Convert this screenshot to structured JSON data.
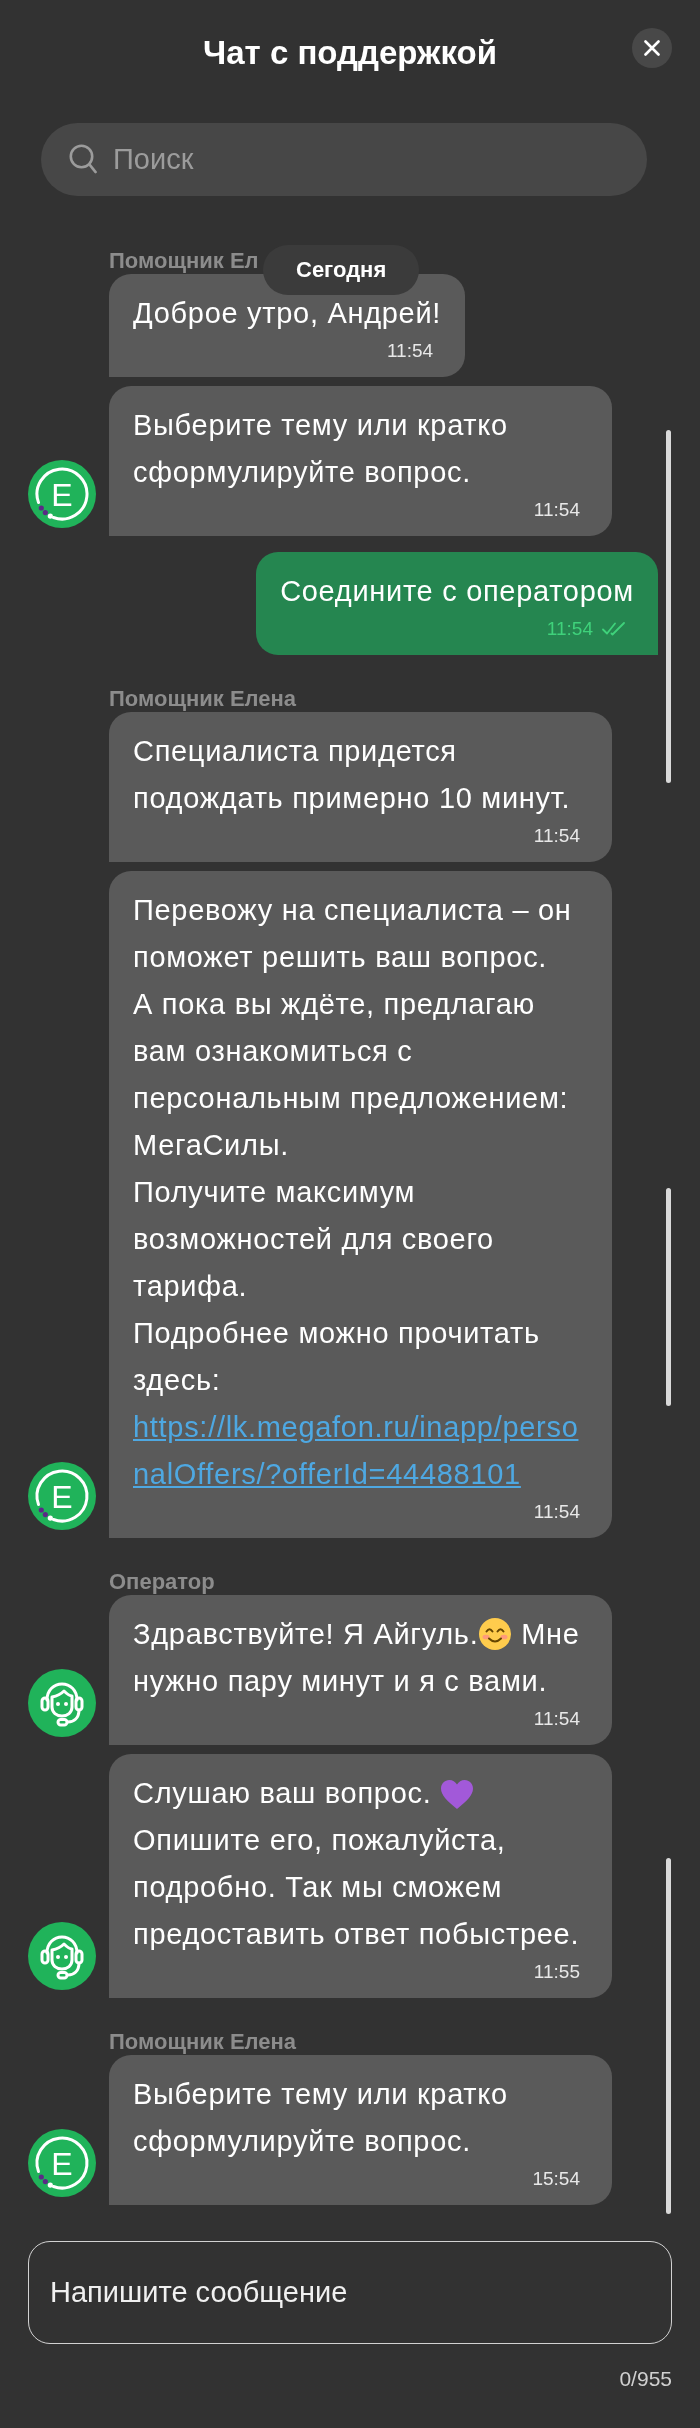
{
  "header": {
    "title": "Чат с поддержкой"
  },
  "search": {
    "placeholder": "Поиск"
  },
  "date_badge": "Сегодня",
  "messages": [
    {
      "kind": "received",
      "author": "Помощник Ел",
      "segments": [
        {
          "kind": "text",
          "text": "Доброе утро, Андрей!"
        }
      ],
      "time": "11:54"
    },
    {
      "kind": "received",
      "avatar": {
        "kind": "bot",
        "letter": "Е"
      },
      "segments": [
        {
          "kind": "text",
          "text": "Выберите тему или кратко сформулируйте вопрос."
        }
      ],
      "time": "11:54"
    },
    {
      "kind": "sent",
      "segments": [
        {
          "kind": "text",
          "text": "Соедините с оператором"
        }
      ],
      "time": "11:54",
      "read": true
    },
    {
      "kind": "received",
      "author": "Помощник Елена",
      "segments": [
        {
          "kind": "text",
          "text": "Специалиста придется подождать примерно 10 минут."
        }
      ],
      "time": "11:54"
    },
    {
      "kind": "received",
      "avatar": {
        "kind": "bot",
        "letter": "Е"
      },
      "segments": [
        {
          "kind": "text",
          "text": "Перевожу на специалиста – он поможет решить ваш вопрос.\nА пока вы ждёте, предлагаю вам ознакомиться с персональным предложением: МегаСилы.\nПолучите максимум возможностей для своего тарифа.\nПодробнее можно прочитать здесь:"
        },
        {
          "kind": "link",
          "text": "https://lk.megafon.ru/inapp/personalOffers/?offerId=44488101"
        }
      ],
      "time": "11:54"
    },
    {
      "kind": "received",
      "author": "Оператор",
      "avatar": {
        "kind": "operator"
      },
      "segments": [
        {
          "kind": "text",
          "text": "Здравствуйте! Я Айгуль."
        },
        {
          "kind": "smile"
        },
        {
          "kind": "text",
          "text": " Мне нужно пару минут и я с вами."
        }
      ],
      "time": "11:54"
    },
    {
      "kind": "received",
      "avatar": {
        "kind": "operator"
      },
      "segments": [
        {
          "kind": "text",
          "text": "Слушаю ваш вопрос. "
        },
        {
          "kind": "heart"
        },
        {
          "kind": "text",
          "text": "\nОпишите его, пожалуйста, подробно. Так мы сможем предоставить ответ побыстрее."
        }
      ],
      "time": "11:55"
    },
    {
      "kind": "received",
      "author": "Помощник Елена",
      "avatar": {
        "kind": "bot",
        "letter": "Е"
      },
      "segments": [
        {
          "kind": "text",
          "text": "Выберите тему или кратко сформулируйте вопрос."
        }
      ],
      "time": "15:54"
    }
  ],
  "composer": {
    "placeholder": "Напишите сообщение",
    "counter": "0/955"
  }
}
